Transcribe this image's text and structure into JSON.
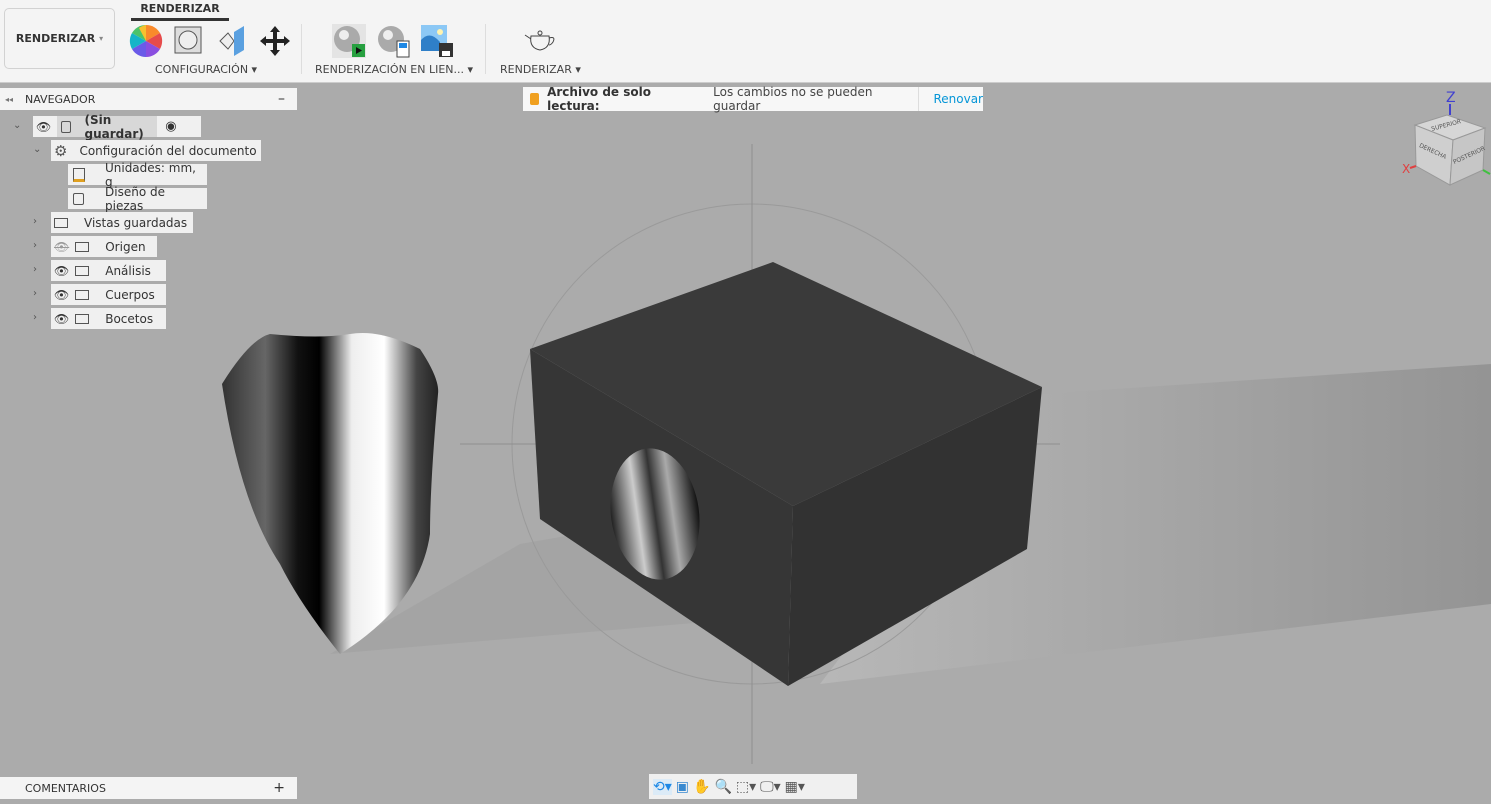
{
  "toolbar": {
    "workspace": "RENDERIZAR",
    "active_tab": "RENDERIZAR",
    "groups": {
      "config": "CONFIGURACIÓN",
      "inline": "RENDERIZACIÓN EN LIEN...",
      "render": "RENDERIZAR"
    },
    "icons": [
      "appearance-icon",
      "scene-settings-icon",
      "texture-map-icon",
      "move-icon",
      "inline-render-icon",
      "inline-render-settings-icon",
      "capture-image-icon",
      "render-teapot-icon"
    ]
  },
  "browser": {
    "title": "NAVEGADOR",
    "root": "(Sin guardar)",
    "items": [
      {
        "label": "Configuración del documento"
      },
      {
        "label": "Unidades: mm, g"
      },
      {
        "label": "Diseño de piezas"
      },
      {
        "label": "Vistas guardadas"
      },
      {
        "label": "Origen"
      },
      {
        "label": "Análisis"
      },
      {
        "label": "Cuerpos"
      },
      {
        "label": "Bocetos"
      }
    ]
  },
  "banner": {
    "title": "Archivo de solo lectura:",
    "message": "Los cambios no se pueden guardar",
    "action": "Renovar",
    "accent": "#f0a020",
    "link_color": "#0696d7"
  },
  "viewcube": {
    "top": "SUPERIOR",
    "left": "DERECHA",
    "right": "POSTERIOR",
    "z": "Z",
    "x": "X"
  },
  "comments": {
    "title": "COMENTARIOS"
  },
  "navbar": [
    "orbit-icon",
    "look-at-icon",
    "pan-icon",
    "zoom-icon",
    "fit-icon",
    "display-settings-icon",
    "grid-icon"
  ]
}
